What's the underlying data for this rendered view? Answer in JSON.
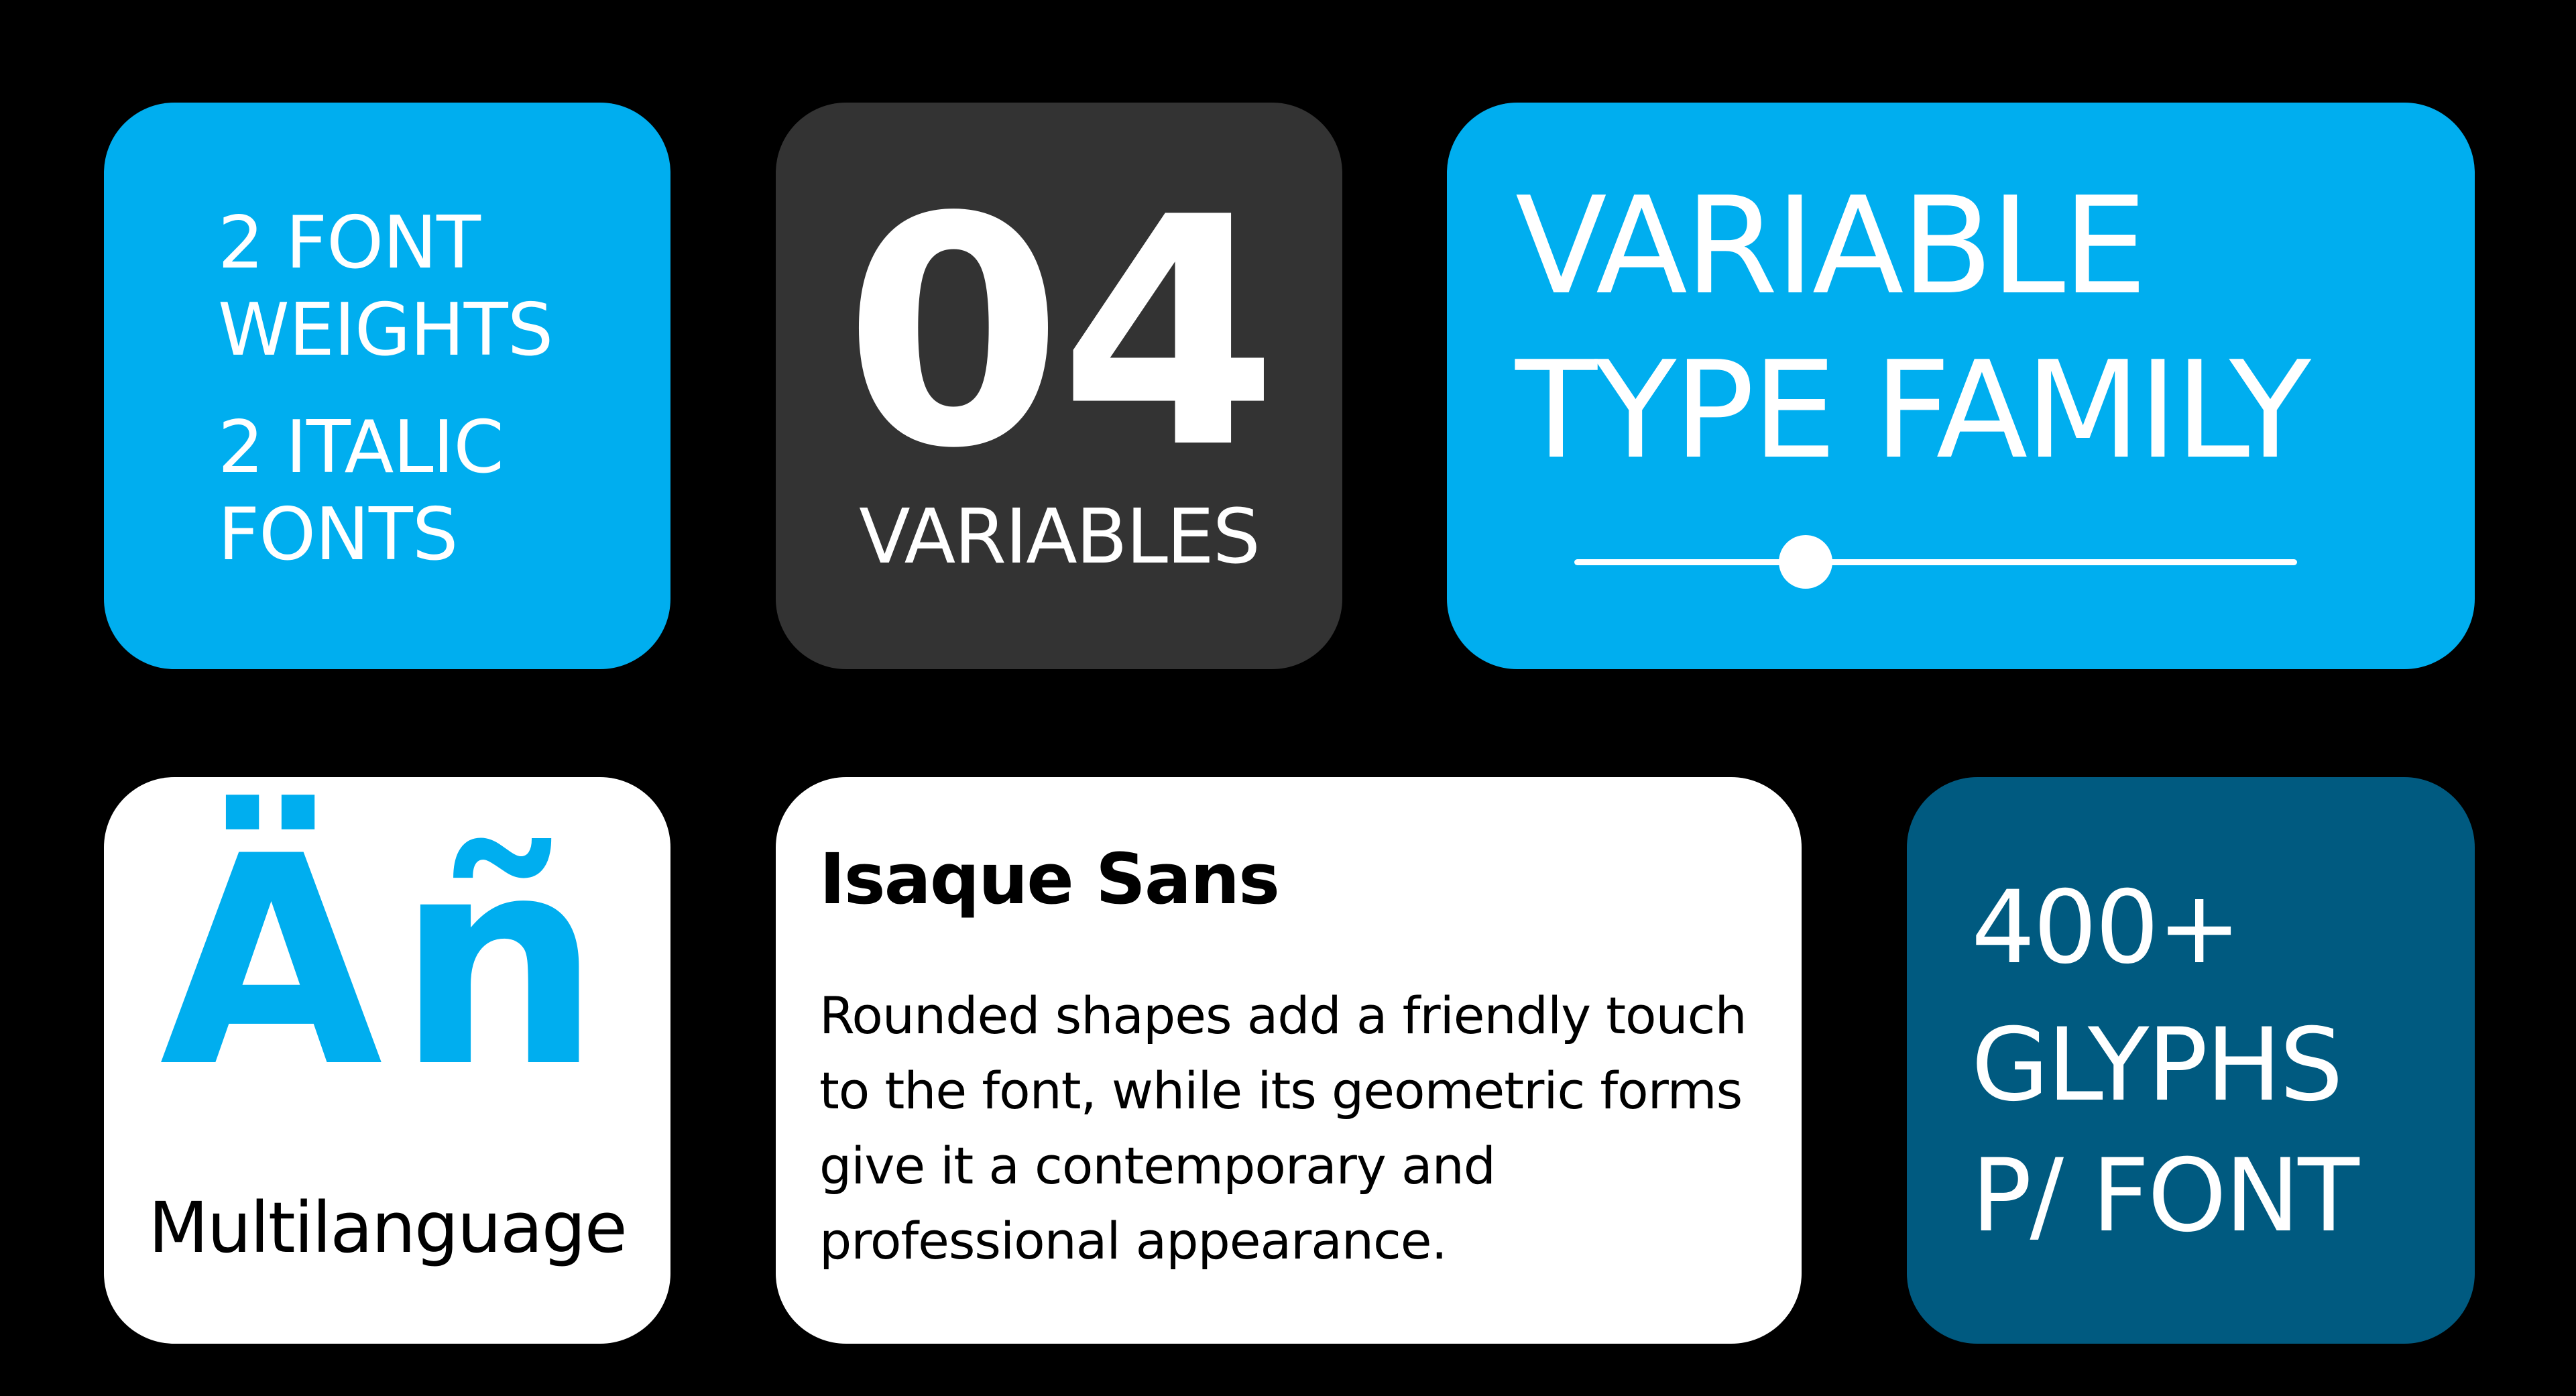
{
  "colors": {
    "background": "#000000",
    "accent_blue": "#00AEEF",
    "dark_gray": "#333333",
    "deep_blue": "#005A80",
    "white": "#FFFFFF"
  },
  "weights_card": {
    "line1": "2 FONT",
    "line2": "WEIGHTS",
    "line3": "2 ITALIC",
    "line4": "FONTS"
  },
  "variables_card": {
    "number": "04",
    "label": "VARIABLES"
  },
  "family_card": {
    "line1": "VARIABLE",
    "line2": "TYPE FAMILY",
    "slider_icon": "slider-icon"
  },
  "language_card": {
    "glyphs": "Äñ",
    "label": "Multilanguage"
  },
  "description_card": {
    "title": "Isaque Sans",
    "body": "Rounded shapes add a friendly touch to the font, while its geometric forms give it a contemporary and professional appearance."
  },
  "glyphs_card": {
    "line1": "400+",
    "line2": "GLYPHS",
    "line3": "P/ FONT"
  }
}
